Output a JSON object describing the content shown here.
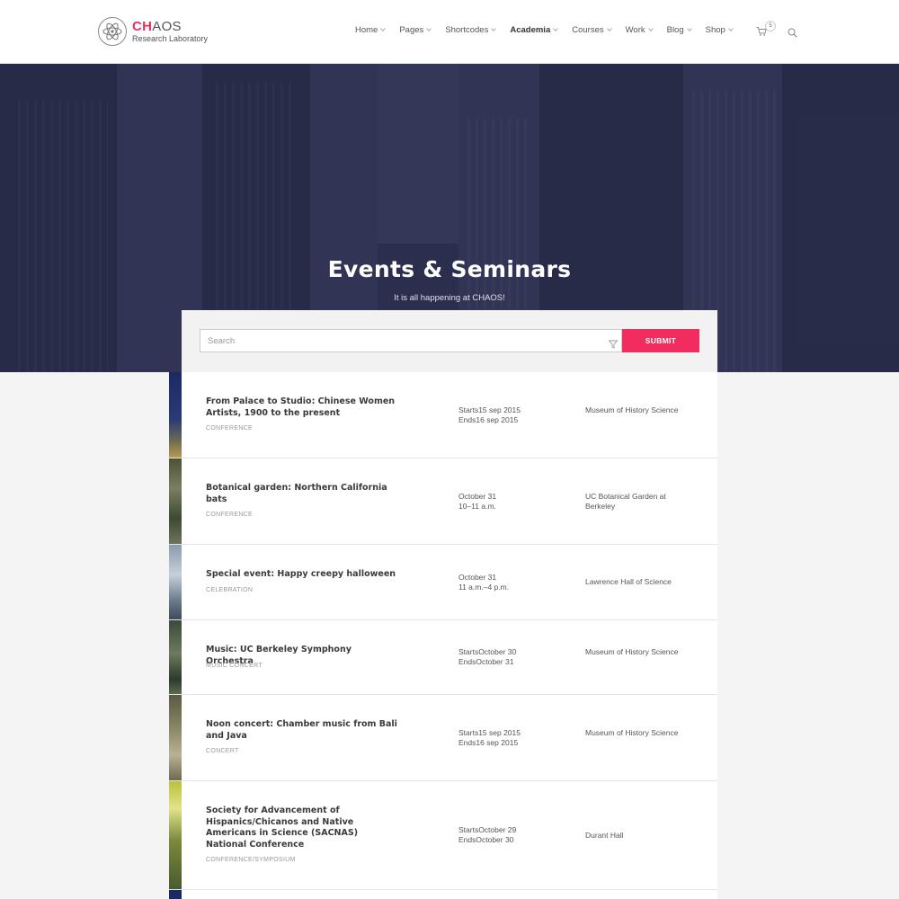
{
  "header": {
    "logo_accent": "CH",
    "logo_rest": "AOS",
    "logo_sub": "Research Laboratory",
    "nav": [
      {
        "label": "Home",
        "active": false
      },
      {
        "label": "Pages",
        "active": false
      },
      {
        "label": "Shortcodes",
        "active": false
      },
      {
        "label": "Academia",
        "active": true
      },
      {
        "label": "Courses",
        "active": false
      },
      {
        "label": "Work",
        "active": false
      },
      {
        "label": "Blog",
        "active": false
      },
      {
        "label": "Shop",
        "active": false
      }
    ],
    "cart_count": "5",
    "icons": {
      "cart": "cart-icon",
      "search": "search-icon",
      "logo": "atom-icon"
    }
  },
  "hero": {
    "title": "Events & Seminars",
    "subtitle": "It is all happening at CHAOS!"
  },
  "search": {
    "placeholder": "Search",
    "value": "",
    "submit_label": "SUBMIT",
    "accent_color": "#f12c5f"
  },
  "events": [
    {
      "title": "From Palace to Studio: Chinese Women Artists, 1900 to the present",
      "category": "CONFERENCE",
      "date_line1": "Starts15 sep 2015",
      "date_line2": "Ends16 sep 2015",
      "location": "Museum of History Science"
    },
    {
      "title": "Botanical garden: Northern California bats",
      "category": "CONFERENCE",
      "date_line1": "October 31",
      "date_line2": "10–11 a.m.",
      "location": "UC Botanical Garden at Berkeley"
    },
    {
      "title": "Special event: Happy creepy halloween",
      "category": "CELEBRATION",
      "date_line1": "October 31",
      "date_line2": "11 a.m.–4 p.m.",
      "location": "Lawrence Hall of Science"
    },
    {
      "title": "Music: UC Berkeley Symphony Orchestra",
      "category": "MUSIC CONCERT",
      "date_line1": "StartsOctober 30",
      "date_line2": "EndsOctober 31",
      "location": "Museum of History Science"
    },
    {
      "title": "Noon concert: Chamber music from Bali and Java",
      "category": "CONCERT",
      "date_line1": "Starts15 sep 2015",
      "date_line2": "Ends16 sep 2015",
      "location": "Museum of History Science"
    },
    {
      "title": "Society for Advancement of Hispanics/Chicanos and Native Americans in Science (SACNAS) National Conference",
      "category": "CONFERENCE/SYMPOSIUM",
      "date_line1": "StartsOctober 29",
      "date_line2": "EndsOctober 30",
      "location": "Durant Hall"
    }
  ]
}
